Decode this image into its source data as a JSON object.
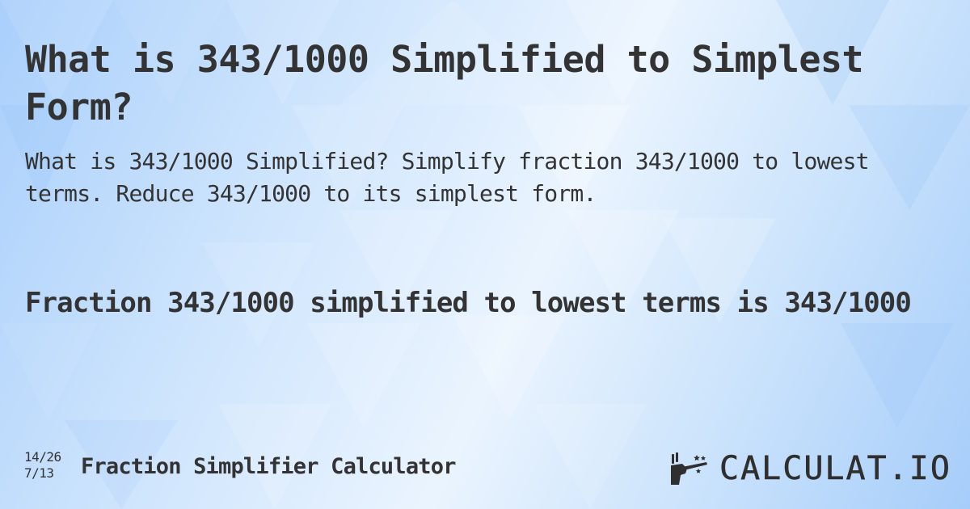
{
  "title": "What is 343/1000 Simplified to Simplest Form?",
  "subtitle": "What is 343/1000 Simplified? Simplify fraction 343/1000 to lowest terms. Reduce 343/1000 to its simplest form.",
  "answer": "Fraction 343/1000 simplified to lowest terms is 343/1000",
  "footer": {
    "fraction_top": "14/26",
    "fraction_bottom": "7/13",
    "calculator_name": "Fraction Simplifier Calculator"
  },
  "logo": {
    "icon": "magic-wand-hand-icon",
    "text": "CALCULAT.IO"
  },
  "colors": {
    "text": "#333333",
    "background_light": "#eaf4fe",
    "background_blue": "#a9cffb"
  }
}
